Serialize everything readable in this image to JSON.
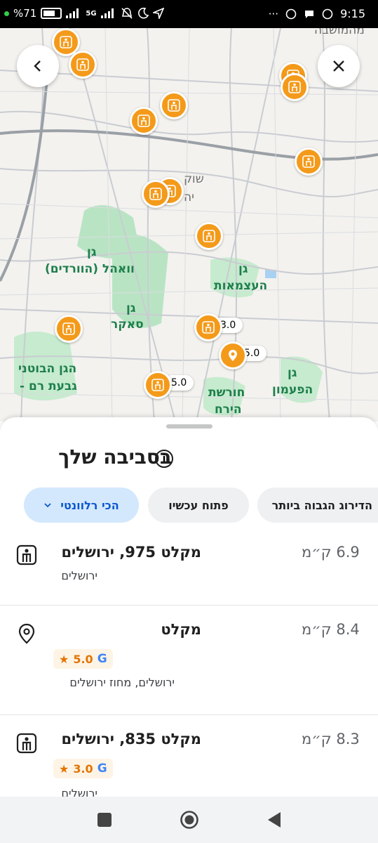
{
  "status_bar": {
    "battery": "71",
    "network": "5G",
    "time": "9:15",
    "icons": [
      "battery-icon",
      "signal-icon",
      "network-5g-icon",
      "mute-icon",
      "moon-icon",
      "location-arrow-icon",
      "more-icon",
      "whatsapp-icon",
      "chat-icon",
      "whatsapp-icon"
    ]
  },
  "map": {
    "labels": [
      {
        "text": "גן",
        "style": "green"
      },
      {
        "text": "וואהל (הוורדים)",
        "style": "green"
      },
      {
        "text": "גן",
        "style": "green"
      },
      {
        "text": "סאקר",
        "style": "green"
      },
      {
        "text": "הגן הבוטני",
        "style": "green"
      },
      {
        "text": "- גבעת רם",
        "style": "green"
      },
      {
        "text": "גן",
        "style": "green"
      },
      {
        "text": "העצמאות",
        "style": "green"
      },
      {
        "text": "חורשת",
        "style": "green"
      },
      {
        "text": "הירח",
        "style": "green"
      },
      {
        "text": "גן",
        "style": "green"
      },
      {
        "text": "הפעמון",
        "style": "green"
      },
      {
        "text": "שוק",
        "style": "gray"
      },
      {
        "text": "יה",
        "style": "gray"
      },
      {
        "text": "מהמושבה",
        "style": "gray"
      }
    ],
    "ratings": [
      "3.0",
      "5.0",
      "5.0"
    ],
    "accent_color": "#f49a1a"
  },
  "header_buttons": {
    "back": "chevron-left-icon",
    "close": "close-icon"
  },
  "sheet": {
    "title": "בסביבה שלך",
    "info_icon": "i",
    "chips": [
      {
        "label": "הכי רלוונטי",
        "selected": true
      },
      {
        "label": "פתוח עכשיו",
        "selected": false
      },
      {
        "label": "הדירוג הגבוה ביותר",
        "selected": false
      }
    ],
    "results": [
      {
        "name": "מקלט 975, ירושלים",
        "distance": "6.9 ק״מ",
        "rating": "",
        "address": "ירושלים",
        "icon": "shelter-icon"
      },
      {
        "name": "מקלט",
        "distance": "8.4 ק״מ",
        "rating": "5.0",
        "address": "ירושלים, מחוז ירושלים",
        "icon": "location-pin-icon"
      },
      {
        "name": "מקלט 835, ירושלים",
        "distance": "8.3 ק״מ",
        "rating": "3.0",
        "address": "ירושלים",
        "icon": "shelter-icon"
      }
    ],
    "google_letter": "G"
  },
  "nav_bar": {
    "icons": [
      "recents-square-icon",
      "home-circle-icon",
      "back-triangle-icon"
    ]
  }
}
